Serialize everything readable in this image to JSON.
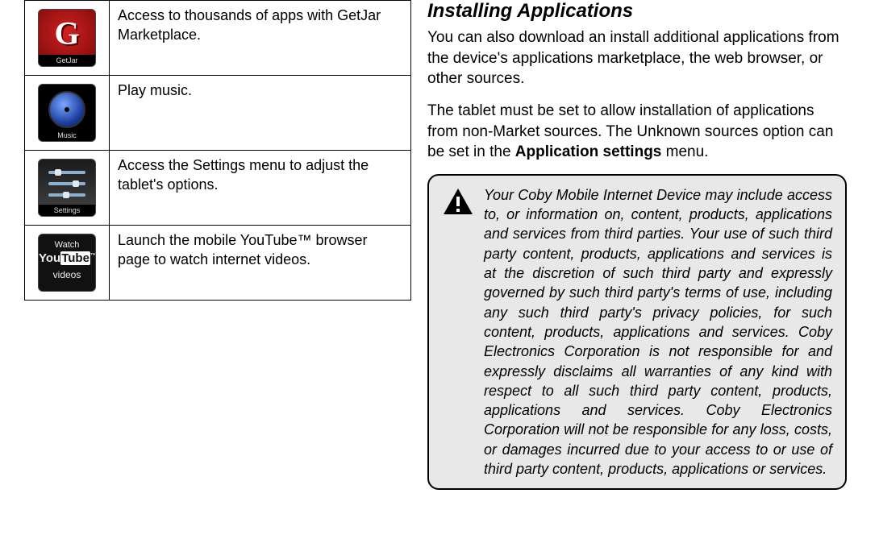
{
  "apps": {
    "getjar": {
      "icon_label": "GetJar",
      "desc": "Access to thousands of apps with GetJar Marketplace."
    },
    "music": {
      "icon_label": "Music",
      "desc": "Play music."
    },
    "settings": {
      "icon_label": "Settings",
      "desc": "Access the Settings menu to adjust the tablet's options."
    },
    "youtube": {
      "line1": "Watch",
      "line2a": "You",
      "line2b": "Tube",
      "tm": "™",
      "line3": "videos",
      "desc": "Launch the mobile YouTube™ browser page to watch internet videos."
    }
  },
  "right": {
    "heading": "Installing Applications",
    "p1": "You can also download an install additional applications from the device's applications marketplace, the web browser, or other sources.",
    "p2a": "The tablet must be set to allow installation of applications from non-Market sources. The Unknown sources option can be set in the ",
    "p2b": "Application settings",
    "p2c": " menu.",
    "note": "Your Coby Mobile Internet Device may include access to, or information on, content, products, applications and services from third parties. Your use of such third party content, products, applications and services is at the discretion of such third party and expressly governed by such third party's terms of use, including any such third party's privacy policies, for such content, products, applications and services. Coby Electronics Corporation is not responsible for and expressly disclaims all warranties of any kind with respect to all such third party content, products, applications and services. Coby Electronics Corporation will not be responsible for any loss, costs, or damages incurred due to your access to or use of third party content, products, applications or services."
  }
}
